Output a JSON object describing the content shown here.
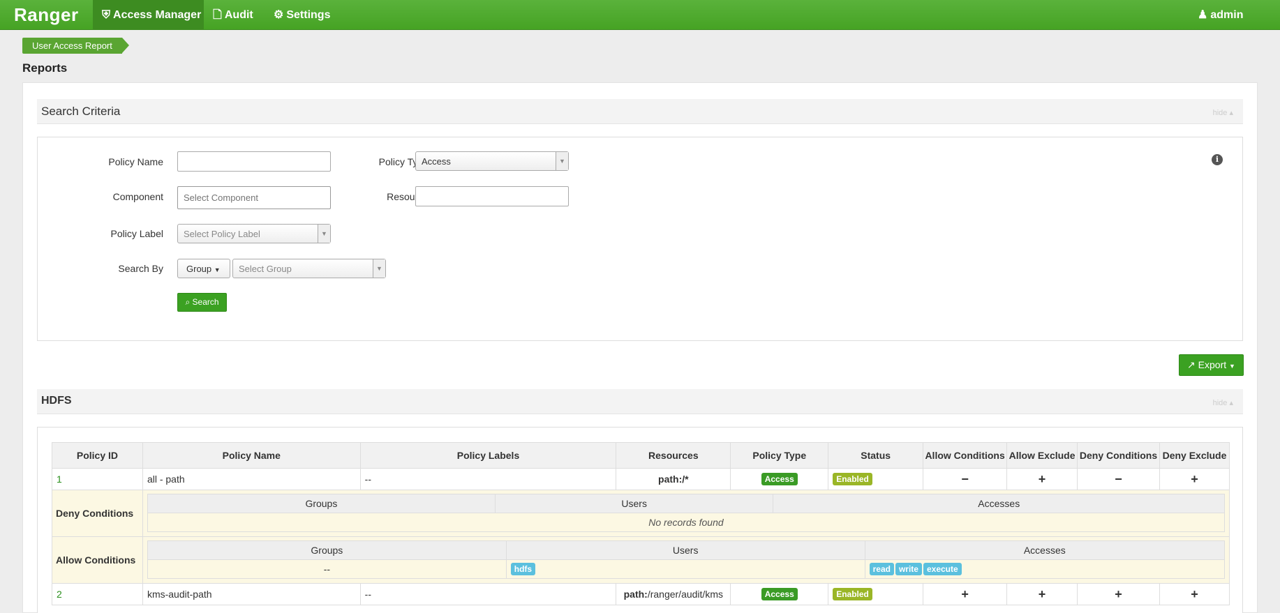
{
  "nav": {
    "brand": "Ranger",
    "items": [
      {
        "label": "Access Manager",
        "icon": "shield-icon"
      },
      {
        "label": "Audit",
        "icon": "file-icon"
      },
      {
        "label": "Settings",
        "icon": "gear-icon"
      }
    ],
    "user": "admin"
  },
  "breadcrumb": "User Access Report",
  "page_title": "Reports",
  "search_criteria": {
    "title": "Search Criteria",
    "hide_label": "hide",
    "policy_name": {
      "label": "Policy Name",
      "value": ""
    },
    "policy_type": {
      "label": "Policy Type",
      "value": "Access"
    },
    "component": {
      "label": "Component",
      "placeholder": "Select Component"
    },
    "resource": {
      "label": "Resource",
      "value": ""
    },
    "policy_label": {
      "label": "Policy Label",
      "placeholder": "Select Policy Label"
    },
    "search_by": {
      "label": "Search By",
      "mode": "Group",
      "placeholder": "Select Group"
    },
    "search_button": "Search"
  },
  "export_button": "Export",
  "hdfs_section": {
    "title": "HDFS",
    "hide_label": "hide",
    "columns": [
      "Policy ID",
      "Policy Name",
      "Policy Labels",
      "Resources",
      "Policy Type",
      "Status",
      "Allow Conditions",
      "Allow Exclude",
      "Deny Conditions",
      "Deny Exclude"
    ],
    "rows": [
      {
        "id": "1",
        "name": "all - path",
        "labels": "--",
        "resource_key": "path:",
        "resource_val": "/*",
        "type": "Access",
        "status": "Enabled",
        "allow_cond": "−",
        "allow_excl": "+",
        "deny_cond": "−",
        "deny_excl": "+"
      },
      {
        "id": "2",
        "name": "kms-audit-path",
        "labels": "--",
        "resource_key": "path:",
        "resource_val": "/ranger/audit/kms",
        "type": "Access",
        "status": "Enabled",
        "allow_cond": "+",
        "allow_excl": "+",
        "deny_cond": "+",
        "deny_excl": "+"
      }
    ],
    "deny_conditions": {
      "label": "Deny Conditions",
      "columns": [
        "Groups",
        "Users",
        "Accesses"
      ],
      "empty": "No records found"
    },
    "allow_conditions": {
      "label": "Allow Conditions",
      "columns": [
        "Groups",
        "Users",
        "Accesses"
      ],
      "groups": "--",
      "users": [
        "hdfs"
      ],
      "accesses": [
        "read",
        "write",
        "execute"
      ]
    }
  }
}
